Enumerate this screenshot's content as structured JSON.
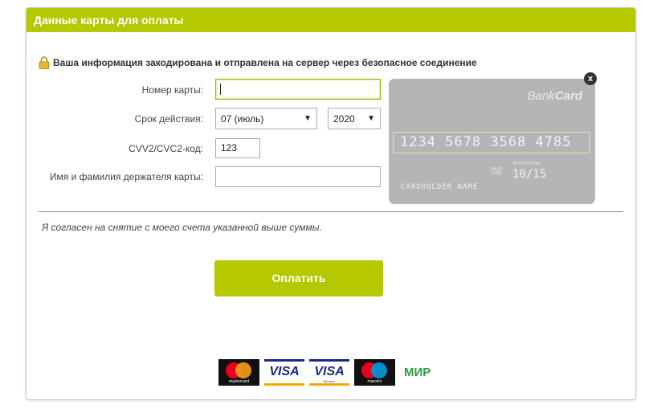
{
  "header": {
    "title": "Данные карты для оплаты"
  },
  "secure_notice": "Ваша информация закодирована и отправлена на сервер через безопасное соединение",
  "form": {
    "card_number_label": "Номер карты:",
    "card_number_value": "",
    "expiry_label": "Срок действия:",
    "expiry_month": "07 (июль)",
    "expiry_year": "2020",
    "cvv_label": "CVV2/CVC2-код:",
    "cvv_value": "123",
    "holder_label": "Имя и фамилия держателя карты:",
    "holder_value": ""
  },
  "card_preview": {
    "brand_prefix": "Bank",
    "brand_suffix": "Card",
    "number": "1234 5678 3568 4785",
    "valid_thru_label": "VALID THRU",
    "month_year_label": "MONTH/YEAR",
    "expiry": "10/15",
    "holder_name": "CARDHOLDER NAME",
    "close_glyph": "x"
  },
  "consent_text": "Я согласен на снятие с моего счета указанной выше суммы.",
  "pay_button_label": "Оплатить",
  "payment_logos": {
    "mastercard": "mastercard",
    "visa": "VISA",
    "visa_electron": "VISA",
    "visa_electron_sub": "Electron",
    "maestro": "maestro",
    "mir": "МИР"
  },
  "colors": {
    "accent": "#b6c800",
    "card_bg": "#b4b5b7"
  },
  "icons": {
    "lock": "lock-icon",
    "close": "close-icon",
    "dropdown": "chevron-down-icon"
  }
}
